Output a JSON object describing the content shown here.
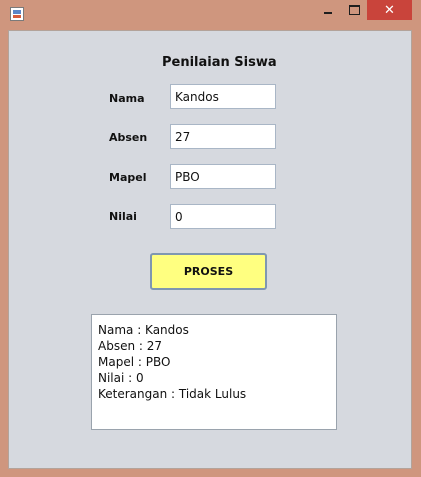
{
  "window": {
    "icon": "java-app-icon",
    "controls": {
      "minimize": "minimize-icon",
      "maximize": "maximize-icon",
      "close_label": "✕"
    },
    "accent_color": "#cf967e",
    "close_color": "#c9443b"
  },
  "form": {
    "title": "Penilaian Siswa",
    "fields": [
      {
        "label": "Nama",
        "value": "Kandos"
      },
      {
        "label": "Absen",
        "value": "27"
      },
      {
        "label": "Mapel",
        "value": "PBO"
      },
      {
        "label": "Nilai",
        "value": "0"
      }
    ],
    "button_label": "PROSES",
    "button_color": "#ffff80"
  },
  "output": {
    "lines": [
      "Nama : Kandos",
      "Absen : 27",
      "Mapel : PBO",
      "Nilai : 0",
      "Keterangan : Tidak Lulus"
    ]
  }
}
